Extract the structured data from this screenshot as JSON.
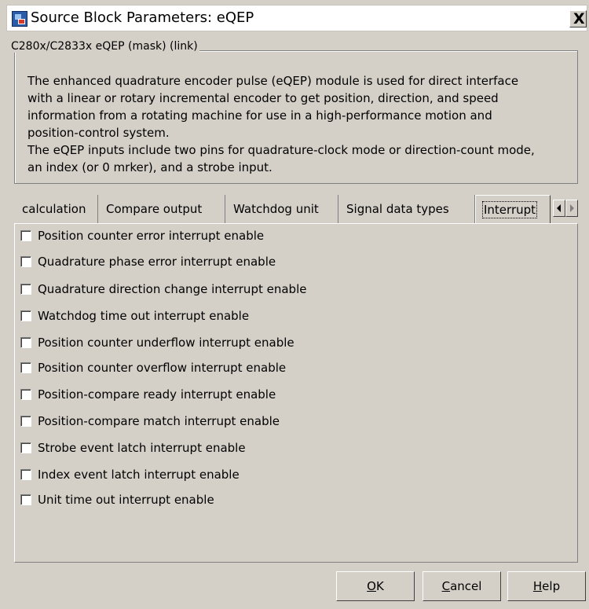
{
  "window": {
    "title": "Source Block Parameters: eQEP",
    "close_label": "X"
  },
  "group": {
    "legend": "C280x/C2833x eQEP (mask) (link)",
    "description": "The enhanced quadrature encoder pulse (eQEP) module is used for direct interface\nwith a linear or rotary incremental encoder to get position, direction, and speed\ninformation from a rotating machine for use in a high-performance motion and\nposition-control system.\nThe eQEP inputs include two pins for quadrature-clock mode or direction-count mode,\nan index (or 0 mrker), and a strobe input."
  },
  "tabs": [
    {
      "label": "calculation",
      "active": false
    },
    {
      "label": "Compare output",
      "active": false
    },
    {
      "label": "Watchdog unit",
      "active": false
    },
    {
      "label": "Signal data types",
      "active": false
    },
    {
      "label": "Interrupt",
      "active": true
    }
  ],
  "checkboxes": [
    {
      "label": "Position counter error interrupt enable",
      "checked": false
    },
    {
      "label": "Quadrature phase error interrupt enable",
      "checked": false
    },
    {
      "label": "Quadrature direction change interrupt enable",
      "checked": false
    },
    {
      "label": "Watchdog time out interrupt enable",
      "checked": false
    },
    {
      "label": "Position counter underflow interrupt enable",
      "checked": false
    },
    {
      "label": "Position counter overflow interrupt enable",
      "checked": false
    },
    {
      "label": "Position-compare ready interrupt enable",
      "checked": false
    },
    {
      "label": "Position-compare match interrupt enable",
      "checked": false
    },
    {
      "label": "Strobe event latch interrupt enable",
      "checked": false
    },
    {
      "label": "Index event latch interrupt enable",
      "checked": false
    },
    {
      "label": "Unit time out interrupt enable",
      "checked": false
    }
  ],
  "buttons": {
    "ok": {
      "mnemonic": "O",
      "rest": "K"
    },
    "cancel": {
      "mnemonic": "C",
      "rest": "ancel"
    },
    "help": {
      "mnemonic": "H",
      "rest": "elp"
    }
  },
  "icons": {
    "app": "simulink-block-icon",
    "tab_left": "arrow-left-icon",
    "tab_right": "arrow-right-icon"
  }
}
